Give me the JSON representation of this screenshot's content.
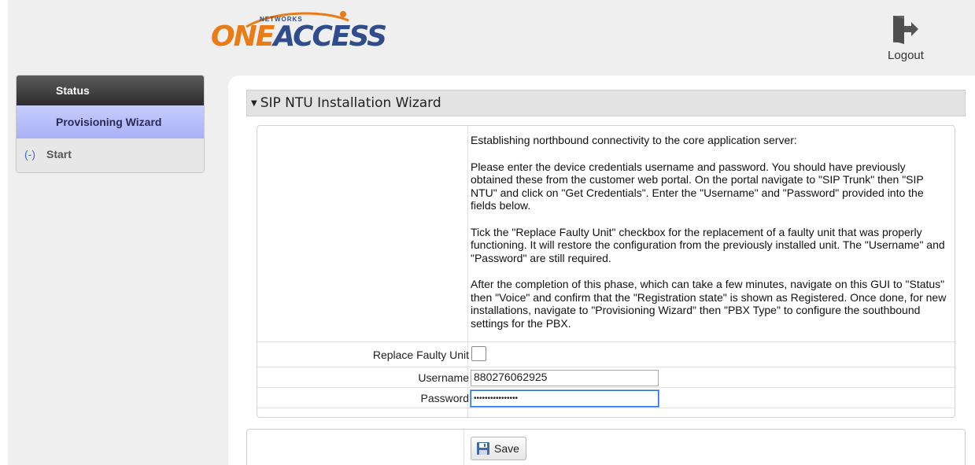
{
  "logo": {
    "brand_part1": "ONE",
    "brand_part2": "ACCESS",
    "tagline": "NETWORKS"
  },
  "header": {
    "logout_label": "Logout",
    "logout_icon": "door-exit-icon"
  },
  "sidebar": {
    "items": [
      {
        "label": "Status"
      },
      {
        "label": "Provisioning Wizard"
      },
      {
        "toggle": "(-)",
        "label": "Start"
      }
    ]
  },
  "wizard": {
    "title": "SIP NTU Installation Wizard",
    "collapse_icon": "triangle-down-icon",
    "paragraphs": [
      "Establishing northbound connectivity to the core application server:",
      "Please enter the device credentials username and password. You should have previously obtained these from the customer web portal. On the portal navigate to \"SIP Trunk\" then \"SIP NTU\" and click on \"Get Credentials\". Enter the \"Username\" and \"Password\" provided into the fields below.",
      "Tick the \"Replace Faulty Unit\" checkbox for the replacement of a faulty unit that was properly functioning. It will restore the configuration from the previously installed unit. The \"Username\" and \"Password\" are still required.",
      "After the completion of this phase, which can take a few minutes, navigate on this GUI to \"Status\" then \"Voice\" and confirm that the \"Registration state\" is shown as Registered. Once done, for new installations, navigate to \"Provisioning Wizard\" then \"PBX Type\" to configure the southbound settings for the PBX."
    ],
    "fields": {
      "replace_label": "Replace Faulty Unit",
      "replace_checked": false,
      "username_label": "Username",
      "username_value": "880276062925",
      "password_label": "Password",
      "password_value": "••••••••••••••••"
    }
  },
  "actions": {
    "save_label": "Save",
    "save_icon": "floppy-disk-icon"
  },
  "colors": {
    "logo_orange": "#e97c16",
    "logo_blue": "#2f4c8c",
    "sidebar_active": "#b4baf8",
    "focus_border": "#2b6fd6"
  }
}
